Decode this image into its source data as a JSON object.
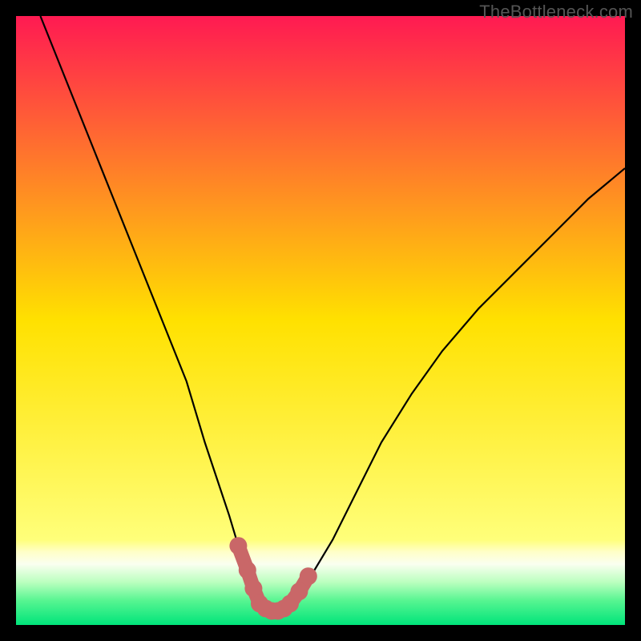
{
  "watermark": "TheBottleneck.com",
  "chart_data": {
    "type": "line",
    "title": "",
    "xlabel": "",
    "ylabel": "",
    "xlim": [
      0,
      100
    ],
    "ylim": [
      0,
      100
    ],
    "background_gradient": {
      "stops": [
        {
          "pos": 0.0,
          "color": "#ff1a52"
        },
        {
          "pos": 0.5,
          "color": "#ffe100"
        },
        {
          "pos": 0.86,
          "color": "#ffff7a"
        },
        {
          "pos": 0.88,
          "color": "#ffffc8"
        },
        {
          "pos": 0.9,
          "color": "#fafff0"
        },
        {
          "pos": 0.93,
          "color": "#baffbe"
        },
        {
          "pos": 0.96,
          "color": "#57f591"
        },
        {
          "pos": 1.0,
          "color": "#00e47a"
        }
      ]
    },
    "series": [
      {
        "name": "bottleneck-curve",
        "x": [
          4,
          8,
          12,
          16,
          20,
          24,
          28,
          31,
          33,
          35,
          36.5,
          38,
          39,
          40,
          41,
          42,
          43,
          44,
          45,
          47,
          49,
          52,
          56,
          60,
          65,
          70,
          76,
          82,
          88,
          94,
          100
        ],
        "y": [
          100,
          90,
          80,
          70,
          60,
          50,
          40,
          30,
          24,
          18,
          13,
          9,
          6,
          4,
          2.8,
          2.3,
          2.3,
          2.8,
          4,
          6,
          9,
          14,
          22,
          30,
          38,
          45,
          52,
          58,
          64,
          70,
          75
        ]
      }
    ],
    "marker_points": {
      "name": "bottom-cluster",
      "color": "#c96768",
      "points": [
        {
          "x": 36.5,
          "y": 13
        },
        {
          "x": 38.0,
          "y": 9
        },
        {
          "x": 39.0,
          "y": 6
        },
        {
          "x": 40.0,
          "y": 3.5
        },
        {
          "x": 41.0,
          "y": 2.7
        },
        {
          "x": 42.0,
          "y": 2.3
        },
        {
          "x": 43.0,
          "y": 2.3
        },
        {
          "x": 44.0,
          "y": 2.7
        },
        {
          "x": 45.0,
          "y": 3.5
        },
        {
          "x": 46.5,
          "y": 5.5
        },
        {
          "x": 48.0,
          "y": 8
        }
      ]
    }
  }
}
